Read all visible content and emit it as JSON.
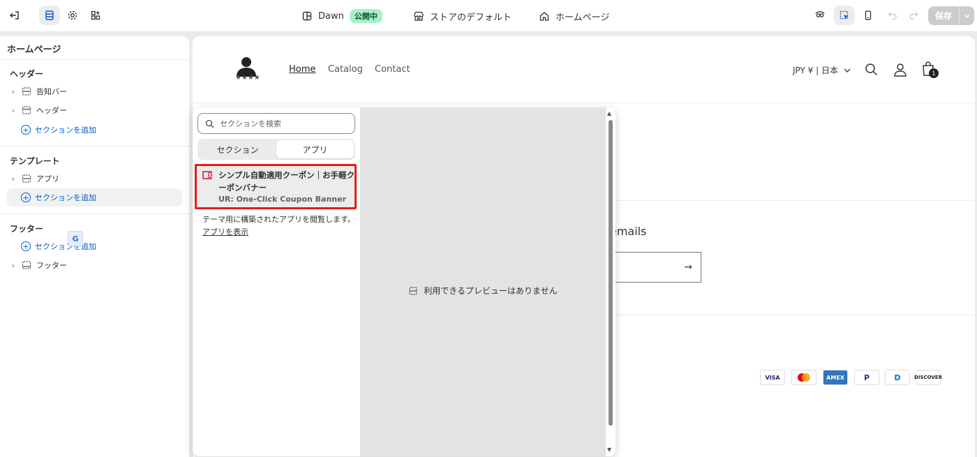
{
  "topbar": {
    "theme_name": "Dawn",
    "theme_status": "公開中",
    "store_default": "ストアのデフォルト",
    "page": "ホームページ",
    "save_label": "保存"
  },
  "sidebar": {
    "title": "ホームページ",
    "header_group": "ヘッダー",
    "header_items": [
      "告知バー",
      "ヘッダー"
    ],
    "template_group": "テンプレート",
    "template_items": [
      "アプリ"
    ],
    "footer_group": "フッター",
    "footer_items": [
      "フッター"
    ],
    "add_section": "セクションを追加"
  },
  "preview": {
    "logo_stars": "★★★★",
    "nav": [
      "Home",
      "Catalog",
      "Contact"
    ],
    "currency": "JPY ¥ | 日本",
    "cart_count": "1",
    "emails_text": "emails",
    "payments": [
      "VISA",
      "MC",
      "AMEX",
      "P",
      "D",
      "DISCOVER"
    ]
  },
  "picker": {
    "search_placeholder": "セクションを検索",
    "tabs": [
      "セクション",
      "アプリ"
    ],
    "selected_tab": "アプリ",
    "item_title": "シンプル自動適用クーポン｜お手軽クーポンバナー",
    "item_subtitle": "UR: One-Click Coupon Banner",
    "note_text": "テーマ用に構築されたアプリを閲覧します。",
    "note_link": "アプリを表示",
    "no_preview": "利用できるプレビューはありません"
  },
  "colors": {
    "accent_blue": "#005bd3",
    "highlight_red": "#e01e1e",
    "live_badge_bg": "#a8f0c6"
  }
}
